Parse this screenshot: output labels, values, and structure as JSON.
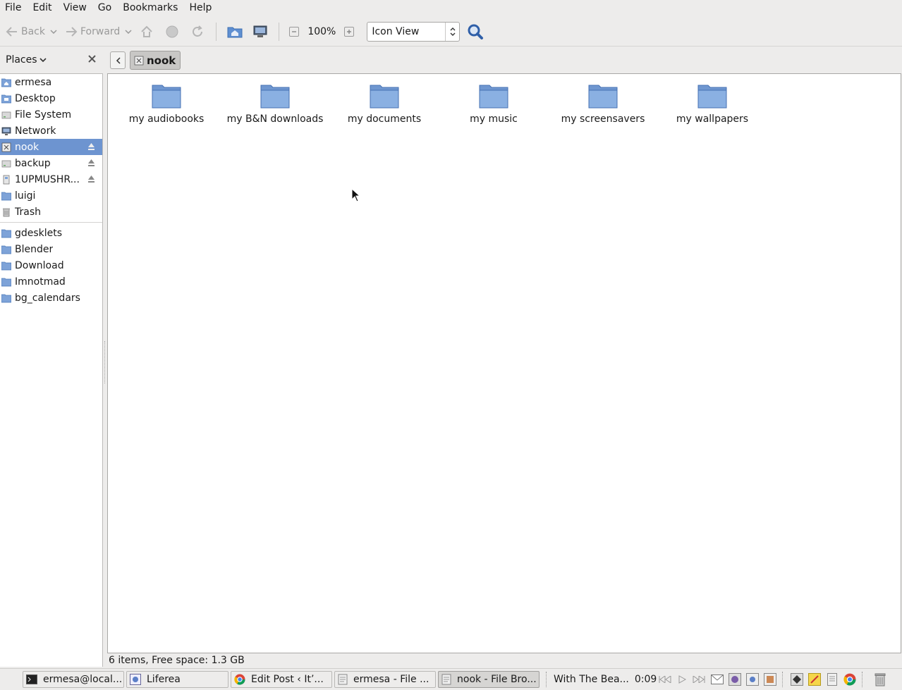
{
  "menubar": {
    "items": [
      "File",
      "Edit",
      "View",
      "Go",
      "Bookmarks",
      "Help"
    ]
  },
  "toolbar": {
    "back_label": "Back",
    "forward_label": "Forward",
    "zoom": "100%",
    "view_mode": "Icon View"
  },
  "sidebar": {
    "title": "Places",
    "places": [
      {
        "label": "ermesa",
        "icon": "home-folder-icon"
      },
      {
        "label": "Desktop",
        "icon": "desktop-folder-icon"
      },
      {
        "label": "File System",
        "icon": "drive-icon"
      },
      {
        "label": "Network",
        "icon": "network-icon"
      },
      {
        "label": "nook",
        "icon": "device-icon",
        "selected": true,
        "eject": true
      },
      {
        "label": "backup",
        "icon": "drive-icon",
        "eject": true
      },
      {
        "label": "1UPMUSHR...",
        "icon": "removable-drive-icon",
        "eject": true
      },
      {
        "label": "luigi",
        "icon": "folder-icon"
      },
      {
        "label": "Trash",
        "icon": "trash-icon"
      }
    ],
    "bookmarks": [
      {
        "label": "gdesklets"
      },
      {
        "label": "Blender"
      },
      {
        "label": "Download"
      },
      {
        "label": "Imnotmad"
      },
      {
        "label": "bg_calendars"
      }
    ]
  },
  "pathbar": {
    "current": "nook"
  },
  "content": {
    "items": [
      {
        "label": "my audiobooks"
      },
      {
        "label": "my B&N downloads"
      },
      {
        "label": "my documents"
      },
      {
        "label": "my music"
      },
      {
        "label": "my screensavers"
      },
      {
        "label": "my wallpapers"
      }
    ]
  },
  "statusbar": {
    "text": "6 items, Free space: 1.3 GB"
  },
  "taskbar": {
    "tasks": [
      {
        "label": "ermesa@local...",
        "icon": "terminal-icon"
      },
      {
        "label": "Liferea",
        "icon": "liferea-icon"
      },
      {
        "label": "Edit Post ‹ It’...",
        "icon": "chrome-icon"
      },
      {
        "label": "ermesa - File ...",
        "icon": "file-browser-icon"
      },
      {
        "label": "nook - File Bro...",
        "icon": "file-browser-icon",
        "active": true
      }
    ],
    "now_playing": {
      "title": "With The Bea...",
      "time": "0:09"
    }
  },
  "colors": {
    "selection": "#6d94d0",
    "folder": "#7ea3d8",
    "window_bg": "#edeceb"
  }
}
